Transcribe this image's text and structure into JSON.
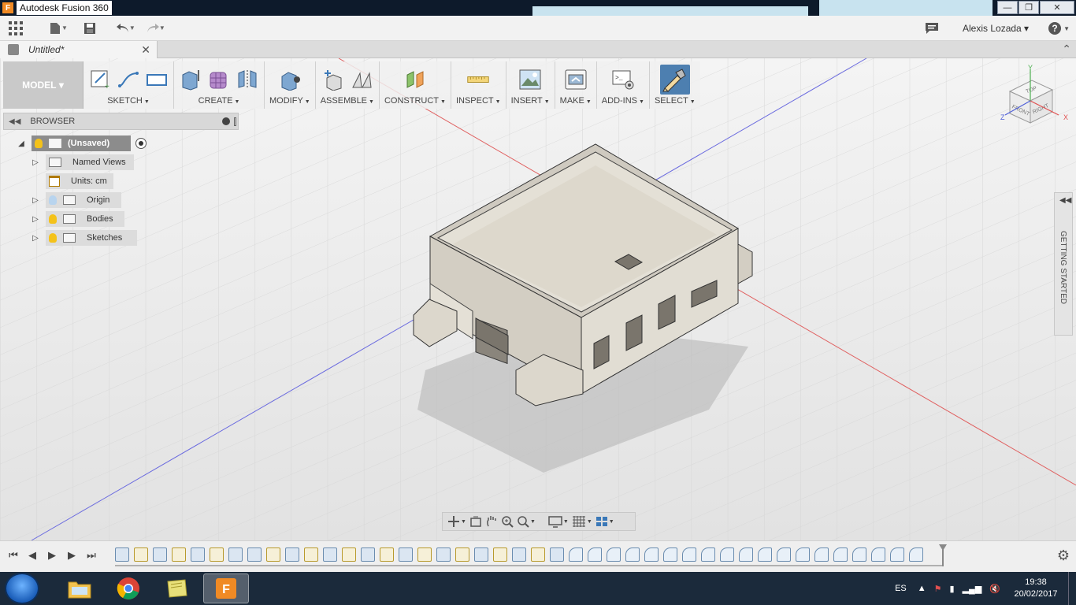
{
  "window": {
    "title": "Autodesk Fusion 360",
    "app_icon_letter": "F",
    "controls": {
      "minimize": "—",
      "maximize": "❐",
      "close": "✕"
    }
  },
  "quick_access": {
    "user_name": "Alexis Lozada"
  },
  "document_tab": {
    "title": "Untitled*",
    "close": "✕"
  },
  "toolbar": {
    "workspace": "MODEL",
    "groups": [
      {
        "label": "SKETCH",
        "icons": [
          "create-sketch-icon",
          "spline-icon",
          "rectangle-icon"
        ]
      },
      {
        "label": "CREATE",
        "icons": [
          "extrude-icon",
          "form-icon",
          "mirror-icon"
        ]
      },
      {
        "label": "MODIFY",
        "icons": [
          "press-pull-icon"
        ]
      },
      {
        "label": "ASSEMBLE",
        "icons": [
          "new-component-icon",
          "joint-icon"
        ]
      },
      {
        "label": "CONSTRUCT",
        "icons": [
          "offset-plane-icon"
        ]
      },
      {
        "label": "INSPECT",
        "icons": [
          "measure-icon"
        ]
      },
      {
        "label": "INSERT",
        "icons": [
          "insert-image-icon"
        ]
      },
      {
        "label": "MAKE",
        "icons": [
          "3d-print-icon"
        ]
      },
      {
        "label": "ADD-INS",
        "icons": [
          "scripts-icon"
        ]
      },
      {
        "label": "SELECT",
        "icons": [
          "select-icon"
        ]
      }
    ]
  },
  "browser": {
    "title": "BROWSER",
    "root": "(Unsaved)",
    "items": [
      {
        "label": "Named Views",
        "icon": "folder-icon",
        "bulb": "none"
      },
      {
        "label": "Units: cm",
        "icon": "units-icon",
        "bulb": "none"
      },
      {
        "label": "Origin",
        "icon": "folder-icon",
        "bulb": "off"
      },
      {
        "label": "Bodies",
        "icon": "folder-icon",
        "bulb": "on"
      },
      {
        "label": "Sketches",
        "icon": "folder-icon",
        "bulb": "on"
      }
    ]
  },
  "viewcube": {
    "top": "TOP",
    "front": "FRONT",
    "right": "RIGHT",
    "axis_x": "X",
    "axis_y": "Y",
    "axis_z": "Z"
  },
  "side_panel": {
    "label": "GETTING STARTED"
  },
  "taskbar": {
    "language": "ES",
    "time": "19:38",
    "date": "20/02/2017"
  },
  "colors": {
    "accent": "#4d7fb0",
    "sketch_feature": "#f6f0d8",
    "taskbar": "#1b2a3b",
    "bulb_on": "#f4c21a"
  }
}
